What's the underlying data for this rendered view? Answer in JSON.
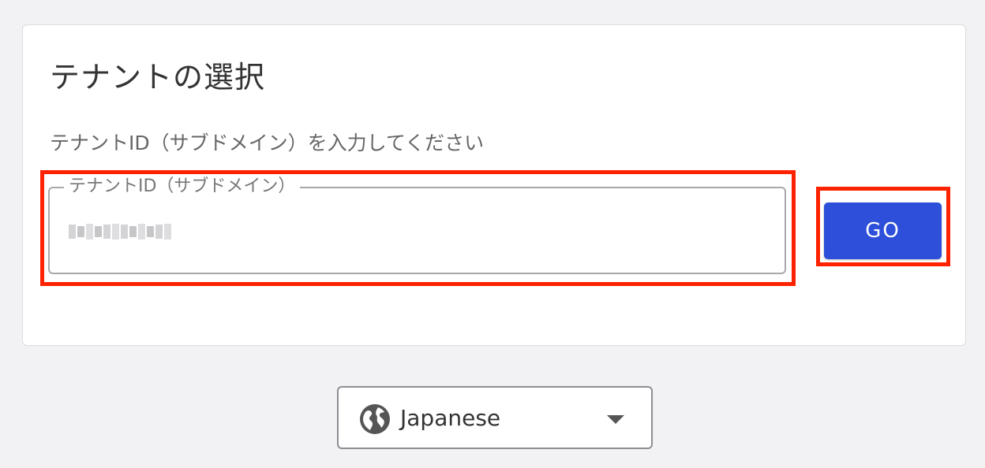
{
  "tenant_card": {
    "title": "テナントの選択",
    "description": "テナントID（サブドメイン）を入力してください",
    "field_label": "テナントID（サブドメイン）",
    "field_value_masked": true,
    "go_label": "GO"
  },
  "language_selector": {
    "selected": "Japanese",
    "icon": "globe-icon"
  },
  "colors": {
    "accent": "#2d4fd9",
    "highlight": "#ff2200",
    "background": "#f2f2f4"
  }
}
